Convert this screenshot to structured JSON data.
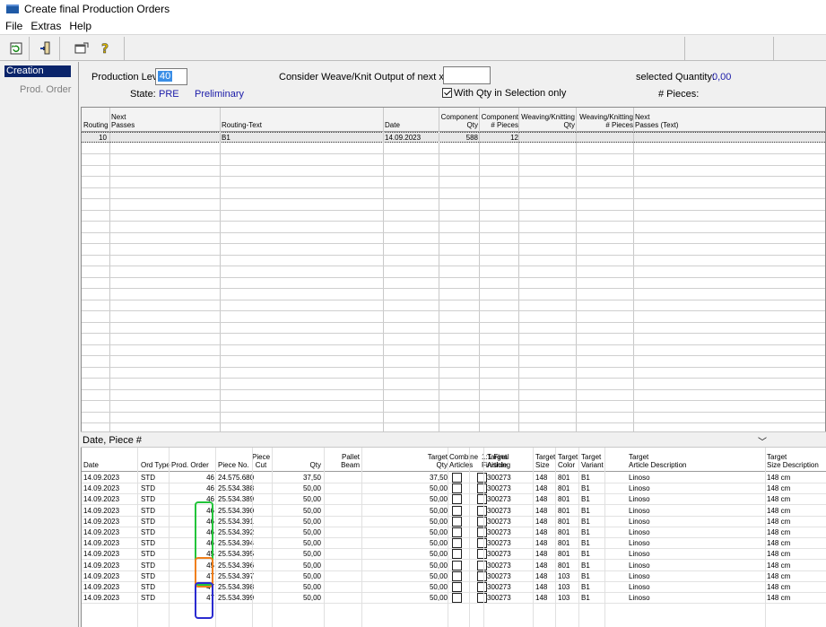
{
  "window": {
    "title": "Create final Production Orders"
  },
  "menu": [
    "File",
    "Extras",
    "Help"
  ],
  "toolbar": {
    "icons": [
      "refresh-icon",
      "exit-icon",
      "properties-icon",
      "help-icon"
    ]
  },
  "sidebar": {
    "selected": "Creation",
    "item": "Prod. Order"
  },
  "form": {
    "production_level_label": "Production Level:",
    "production_level_value": "40",
    "state_label": "State:",
    "state_value": "PRE",
    "state_text": "Preliminary",
    "weave_label": "Consider Weave/Knit Output of next x Hours:",
    "weave_value": "",
    "with_qty_label": "With Qty in Selection only",
    "selected_qty_label": "selected Quantity:",
    "selected_qty_value": "0,00",
    "pieces_label": "# Pieces:"
  },
  "grid1": {
    "headers": [
      "Routing",
      "Next\nPasses",
      "Routing-Text",
      "Date",
      "Component\nQty",
      "Component\n# Pieces",
      "Weaving/Knitting\nQty",
      "Weaving/Knitting\n# Pieces",
      "Next\nPasses (Text)"
    ],
    "row": {
      "routing": "10",
      "next_passes": "",
      "routing_text": "B1",
      "date": "14.09.2023",
      "comp_qty": "588",
      "comp_pieces": "12",
      "wk_qty": "",
      "wk_pieces": "",
      "next_text": ""
    }
  },
  "splitter": {
    "label": "Date, Piece #"
  },
  "grid2": {
    "headers": [
      "Date",
      "Ord Type",
      "Prod. Order",
      "Piece No.",
      "Piece\nCut",
      "Qty",
      "Pallet\nBeam",
      "Target\nQty",
      "Combine\nArticles",
      "1:1 Final\nFinishing",
      "Target\nArticle",
      "Target\nSize",
      "Target\nColor",
      "Target\nVariant",
      "Target\nArticle Description",
      "Target\nSize Description"
    ],
    "rows": [
      {
        "date": "14.09.2023",
        "ord": "STD",
        "prod": "46",
        "piece": "24.575.680",
        "qty": "37,50",
        "tqty": "37,50",
        "art": "300273",
        "size": "148",
        "color": "801",
        "variant": "B1",
        "desc": "Linoso",
        "sdesc": "148 cm"
      },
      {
        "date": "14.09.2023",
        "ord": "STD",
        "prod": "46",
        "piece": "25.534.388",
        "qty": "50,00",
        "tqty": "50,00",
        "art": "300273",
        "size": "148",
        "color": "801",
        "variant": "B1",
        "desc": "Linoso",
        "sdesc": "148 cm"
      },
      {
        "date": "14.09.2023",
        "ord": "STD",
        "prod": "46",
        "piece": "25.534.389",
        "qty": "50,00",
        "tqty": "50,00",
        "art": "300273",
        "size": "148",
        "color": "801",
        "variant": "B1",
        "desc": "Linoso",
        "sdesc": "148 cm"
      },
      {
        "date": "14.09.2023",
        "ord": "STD",
        "prod": "46",
        "piece": "25.534.390",
        "qty": "50,00",
        "tqty": "50,00",
        "art": "300273",
        "size": "148",
        "color": "801",
        "variant": "B1",
        "desc": "Linoso",
        "sdesc": "148 cm"
      },
      {
        "date": "14.09.2023",
        "ord": "STD",
        "prod": "46",
        "piece": "25.534.391",
        "qty": "50,00",
        "tqty": "50,00",
        "art": "300273",
        "size": "148",
        "color": "801",
        "variant": "B1",
        "desc": "Linoso",
        "sdesc": "148 cm"
      },
      {
        "date": "14.09.2023",
        "ord": "STD",
        "prod": "46",
        "piece": "25.534.392",
        "qty": "50,00",
        "tqty": "50,00",
        "art": "300273",
        "size": "148",
        "color": "801",
        "variant": "B1",
        "desc": "Linoso",
        "sdesc": "148 cm"
      },
      {
        "date": "14.09.2023",
        "ord": "STD",
        "prod": "46",
        "piece": "25.534.394",
        "qty": "50,00",
        "tqty": "50,00",
        "art": "300273",
        "size": "148",
        "color": "801",
        "variant": "B1",
        "desc": "Linoso",
        "sdesc": "148 cm"
      },
      {
        "date": "14.09.2023",
        "ord": "STD",
        "prod": "45",
        "piece": "25.534.395",
        "qty": "50,00",
        "tqty": "50,00",
        "art": "300273",
        "size": "148",
        "color": "801",
        "variant": "B1",
        "desc": "Linoso",
        "sdesc": "148 cm"
      },
      {
        "date": "14.09.2023",
        "ord": "STD",
        "prod": "45",
        "piece": "25.534.396",
        "qty": "50,00",
        "tqty": "50,00",
        "art": "300273",
        "size": "148",
        "color": "801",
        "variant": "B1",
        "desc": "Linoso",
        "sdesc": "148 cm"
      },
      {
        "date": "14.09.2023",
        "ord": "STD",
        "prod": "47",
        "piece": "25.534.397",
        "qty": "50,00",
        "tqty": "50,00",
        "art": "300273",
        "size": "148",
        "color": "103",
        "variant": "B1",
        "desc": "Linoso",
        "sdesc": "148 cm"
      },
      {
        "date": "14.09.2023",
        "ord": "STD",
        "prod": "47",
        "piece": "25.534.398",
        "qty": "50,00",
        "tqty": "50,00",
        "art": "300273",
        "size": "148",
        "color": "103",
        "variant": "B1",
        "desc": "Linoso",
        "sdesc": "148 cm"
      },
      {
        "date": "14.09.2023",
        "ord": "STD",
        "prod": "47",
        "piece": "25.534.399",
        "qty": "50,00",
        "tqty": "50,00",
        "art": "300273",
        "size": "148",
        "color": "103",
        "variant": "B1",
        "desc": "Linoso",
        "sdesc": "148 cm"
      }
    ]
  },
  "highlights": {
    "green": "#22c43a",
    "orange": "#f07f1a",
    "blue": "#2b2bd0"
  }
}
